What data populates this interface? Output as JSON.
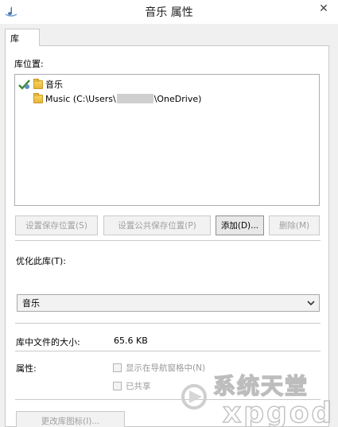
{
  "window": {
    "title": "音乐 属性",
    "close_glyph": "✕"
  },
  "tabs": [
    {
      "label": "库"
    }
  ],
  "library_locations": {
    "label": "库位置:",
    "items": [
      {
        "name": "音乐",
        "default": true
      },
      {
        "prefix": "Music (C:\\Users\\",
        "suffix": "\\OneDrive)"
      }
    ]
  },
  "buttons": {
    "set_save_location": "设置保存位置(S)",
    "set_public_save_location": "设置公共保存位置(P)",
    "add": "添加(D)...",
    "remove": "删除(M)",
    "change_icon": "更改库图标(I)..."
  },
  "optimize": {
    "label": "优化此库(T):",
    "selected": "音乐"
  },
  "size": {
    "label": "库中文件的大小:",
    "value": "65.6 KB"
  },
  "attributes": {
    "label": "属性:",
    "show_in_nav_pane": "显示在导航窗格中(N)",
    "shared": "已共享"
  },
  "watermark": {
    "text": "系统天堂",
    "subtext": "xpgod"
  },
  "colors": {
    "panel_bg": "#ffffff",
    "dialog_bg": "#f0f0f0",
    "disabled_text": "#a0a0a0"
  }
}
